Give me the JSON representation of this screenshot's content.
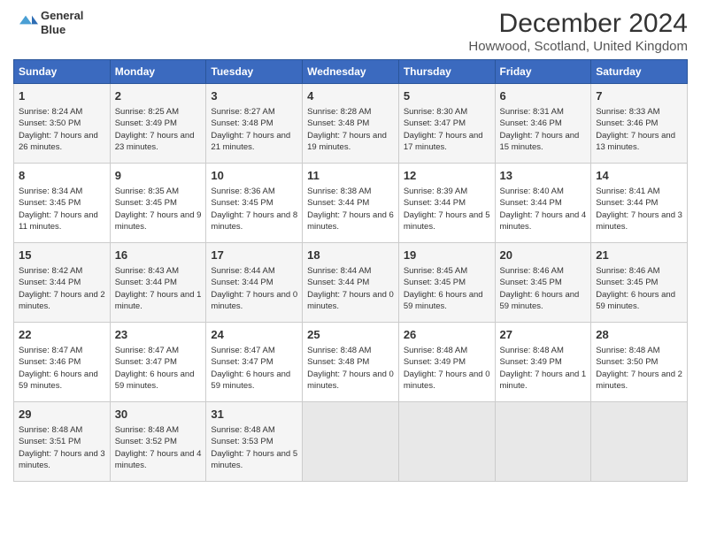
{
  "header": {
    "logo_line1": "General",
    "logo_line2": "Blue",
    "month": "December 2024",
    "location": "Howwood, Scotland, United Kingdom"
  },
  "days_of_week": [
    "Sunday",
    "Monday",
    "Tuesday",
    "Wednesday",
    "Thursday",
    "Friday",
    "Saturday"
  ],
  "weeks": [
    [
      {
        "day": 1,
        "sunrise": "8:24 AM",
        "sunset": "3:50 PM",
        "daylight": "7 hours and 26 minutes."
      },
      {
        "day": 2,
        "sunrise": "8:25 AM",
        "sunset": "3:49 PM",
        "daylight": "7 hours and 23 minutes."
      },
      {
        "day": 3,
        "sunrise": "8:27 AM",
        "sunset": "3:48 PM",
        "daylight": "7 hours and 21 minutes."
      },
      {
        "day": 4,
        "sunrise": "8:28 AM",
        "sunset": "3:48 PM",
        "daylight": "7 hours and 19 minutes."
      },
      {
        "day": 5,
        "sunrise": "8:30 AM",
        "sunset": "3:47 PM",
        "daylight": "7 hours and 17 minutes."
      },
      {
        "day": 6,
        "sunrise": "8:31 AM",
        "sunset": "3:46 PM",
        "daylight": "7 hours and 15 minutes."
      },
      {
        "day": 7,
        "sunrise": "8:33 AM",
        "sunset": "3:46 PM",
        "daylight": "7 hours and 13 minutes."
      }
    ],
    [
      {
        "day": 8,
        "sunrise": "8:34 AM",
        "sunset": "3:45 PM",
        "daylight": "7 hours and 11 minutes."
      },
      {
        "day": 9,
        "sunrise": "8:35 AM",
        "sunset": "3:45 PM",
        "daylight": "7 hours and 9 minutes."
      },
      {
        "day": 10,
        "sunrise": "8:36 AM",
        "sunset": "3:45 PM",
        "daylight": "7 hours and 8 minutes."
      },
      {
        "day": 11,
        "sunrise": "8:38 AM",
        "sunset": "3:44 PM",
        "daylight": "7 hours and 6 minutes."
      },
      {
        "day": 12,
        "sunrise": "8:39 AM",
        "sunset": "3:44 PM",
        "daylight": "7 hours and 5 minutes."
      },
      {
        "day": 13,
        "sunrise": "8:40 AM",
        "sunset": "3:44 PM",
        "daylight": "7 hours and 4 minutes."
      },
      {
        "day": 14,
        "sunrise": "8:41 AM",
        "sunset": "3:44 PM",
        "daylight": "7 hours and 3 minutes."
      }
    ],
    [
      {
        "day": 15,
        "sunrise": "8:42 AM",
        "sunset": "3:44 PM",
        "daylight": "7 hours and 2 minutes."
      },
      {
        "day": 16,
        "sunrise": "8:43 AM",
        "sunset": "3:44 PM",
        "daylight": "7 hours and 1 minute."
      },
      {
        "day": 17,
        "sunrise": "8:44 AM",
        "sunset": "3:44 PM",
        "daylight": "7 hours and 0 minutes."
      },
      {
        "day": 18,
        "sunrise": "8:44 AM",
        "sunset": "3:44 PM",
        "daylight": "7 hours and 0 minutes."
      },
      {
        "day": 19,
        "sunrise": "8:45 AM",
        "sunset": "3:45 PM",
        "daylight": "6 hours and 59 minutes."
      },
      {
        "day": 20,
        "sunrise": "8:46 AM",
        "sunset": "3:45 PM",
        "daylight": "6 hours and 59 minutes."
      },
      {
        "day": 21,
        "sunrise": "8:46 AM",
        "sunset": "3:45 PM",
        "daylight": "6 hours and 59 minutes."
      }
    ],
    [
      {
        "day": 22,
        "sunrise": "8:47 AM",
        "sunset": "3:46 PM",
        "daylight": "6 hours and 59 minutes."
      },
      {
        "day": 23,
        "sunrise": "8:47 AM",
        "sunset": "3:47 PM",
        "daylight": "6 hours and 59 minutes."
      },
      {
        "day": 24,
        "sunrise": "8:47 AM",
        "sunset": "3:47 PM",
        "daylight": "6 hours and 59 minutes."
      },
      {
        "day": 25,
        "sunrise": "8:48 AM",
        "sunset": "3:48 PM",
        "daylight": "7 hours and 0 minutes."
      },
      {
        "day": 26,
        "sunrise": "8:48 AM",
        "sunset": "3:49 PM",
        "daylight": "7 hours and 0 minutes."
      },
      {
        "day": 27,
        "sunrise": "8:48 AM",
        "sunset": "3:49 PM",
        "daylight": "7 hours and 1 minute."
      },
      {
        "day": 28,
        "sunrise": "8:48 AM",
        "sunset": "3:50 PM",
        "daylight": "7 hours and 2 minutes."
      }
    ],
    [
      {
        "day": 29,
        "sunrise": "8:48 AM",
        "sunset": "3:51 PM",
        "daylight": "7 hours and 3 minutes."
      },
      {
        "day": 30,
        "sunrise": "8:48 AM",
        "sunset": "3:52 PM",
        "daylight": "7 hours and 4 minutes."
      },
      {
        "day": 31,
        "sunrise": "8:48 AM",
        "sunset": "3:53 PM",
        "daylight": "7 hours and 5 minutes."
      },
      null,
      null,
      null,
      null
    ]
  ]
}
